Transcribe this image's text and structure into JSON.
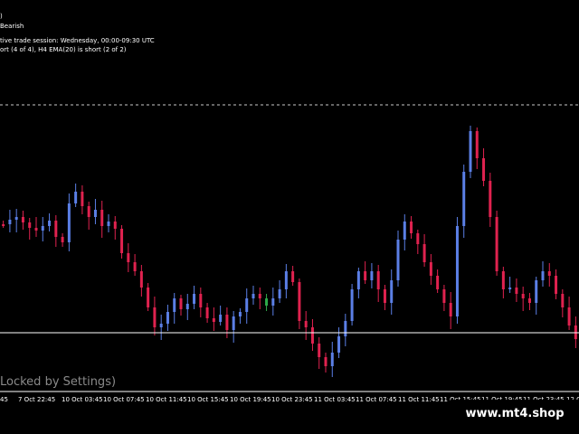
{
  "info": {
    "line1": ")",
    "line2": "Bearish",
    "line3": "tive trade session: Wednesday, 00:00-09:30 UTC",
    "line4": "ort (4 of 4), H4 EMA(20) is short (2 of 2)"
  },
  "locked_label": "Locked by Settings)",
  "watermark": "www.mt4.shop",
  "time_axis": [
    "45",
    "7 Oct 22:45",
    "10 Oct 03:45",
    "10 Oct 07:45",
    "10 Oct 11:45",
    "10 Oct 15:45",
    "10 Oct 19:45",
    "10 Oct 23:45",
    "11 Oct 03:45",
    "11 Oct 07:45",
    "11 Oct 11:45",
    "11 Oct 15:45",
    "11 Oct 19:45",
    "11 Oct 23:45",
    "12 O"
  ],
  "colors": {
    "background": "#000000",
    "bull_candle": "#5b7fe6",
    "bear_candle": "#e0224f",
    "neutral_candle": "#2ea84a",
    "price_line": "#ffffff",
    "level_line": "#ffffff"
  },
  "chart_data": {
    "type": "line",
    "series": [
      {
        "values": [
          248,
          243,
          240,
          246,
          252,
          255,
          250,
          244,
          262,
          268,
          225,
          212,
          228,
          240,
          232,
          250,
          245,
          253,
          280,
          290,
          300,
          318,
          340,
          362,
          358,
          345,
          330,
          342,
          336,
          325,
          340,
          352,
          356,
          348,
          365,
          350,
          345,
          330,
          325,
          330,
          338,
          330,
          320,
          300,
          312,
          355,
          362,
          380,
          395,
          405,
          390,
          372,
          355,
          320,
          300,
          310,
          300,
          320,
          335,
          310,
          265,
          245,
          258,
          270,
          290,
          305,
          320,
          335,
          350,
          250,
          190,
          145,
          175,
          200,
          240,
          300,
          320,
          318,
          325,
          330,
          335,
          310,
          300,
          305,
          325,
          340,
          360,
          375
        ]
      }
    ]
  }
}
